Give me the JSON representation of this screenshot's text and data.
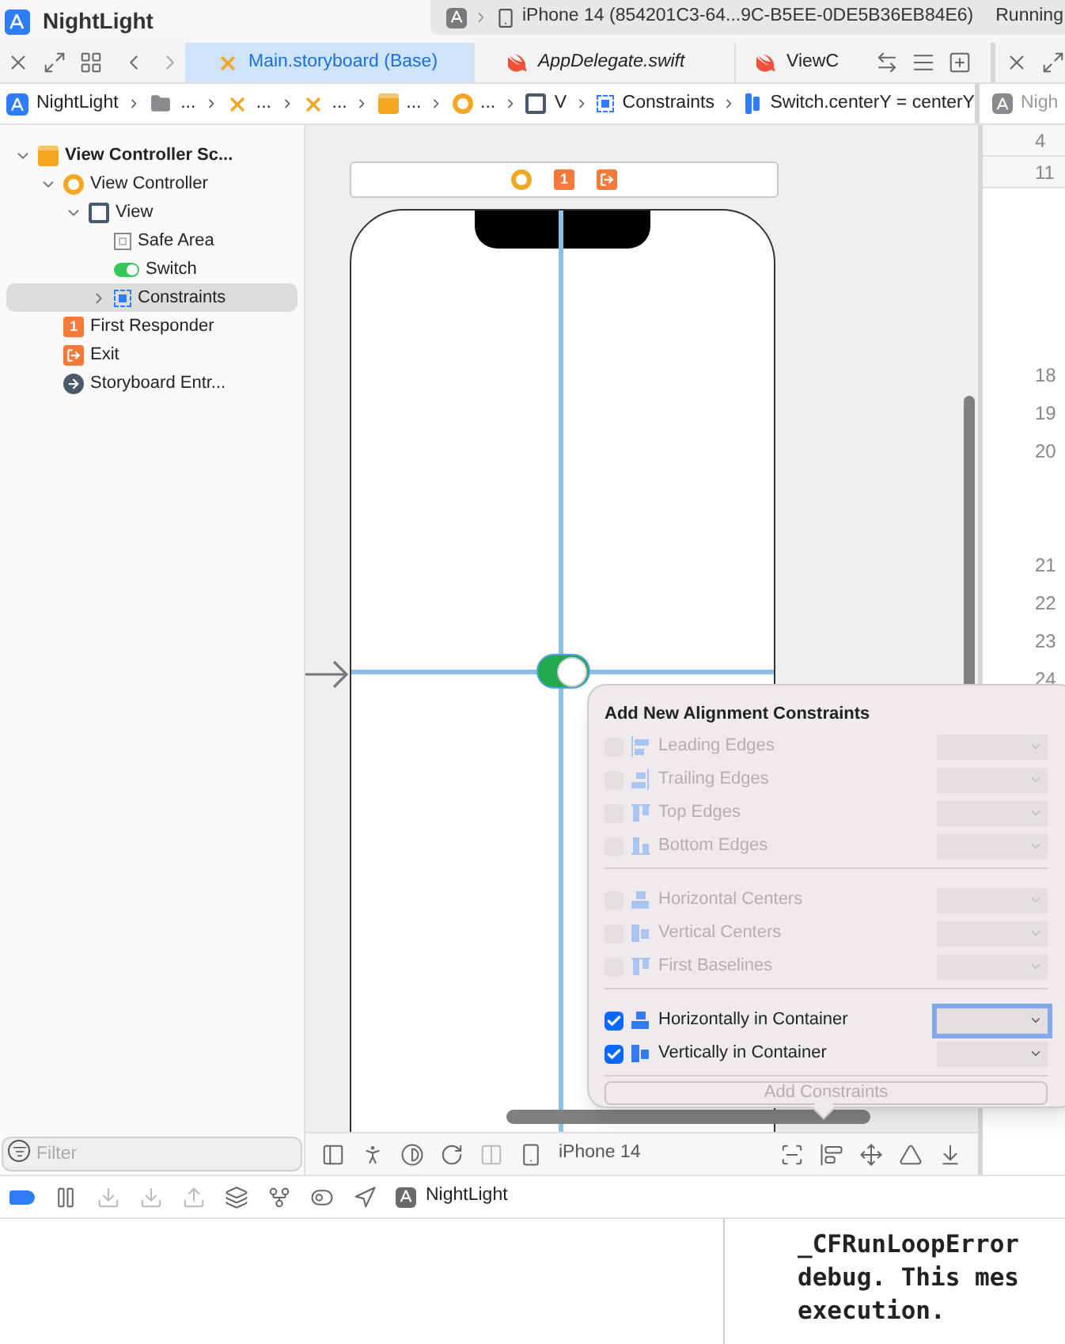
{
  "app": {
    "name": "NightLight"
  },
  "run_status": {
    "device": "iPhone 14 (854201C3-64...9C-B5EE-0DE5B36EB84E6)",
    "status": "Running"
  },
  "tabs": [
    {
      "label": "Main.storyboard (Base)",
      "kind": "storyboard",
      "selected": true
    },
    {
      "label": "AppDelegate.swift",
      "kind": "swift",
      "selected": false
    },
    {
      "label": "ViewC",
      "kind": "swift",
      "selected": false
    }
  ],
  "breadcrumb": [
    {
      "label": "NightLight",
      "kind": "app"
    },
    {
      "label": "...",
      "kind": "folder"
    },
    {
      "label": "...",
      "kind": "storyboard"
    },
    {
      "label": "...",
      "kind": "storyboard"
    },
    {
      "label": "...",
      "kind": "scene"
    },
    {
      "label": "...",
      "kind": "controller"
    },
    {
      "label": "V",
      "kind": "view"
    },
    {
      "label": "Constraints",
      "kind": "constraints"
    },
    {
      "label": "Switch.centerY = centerY",
      "kind": "constraint"
    }
  ],
  "side_breadcrumb": "Nigh",
  "navigator": {
    "items": [
      {
        "label": "View Controller Sc...",
        "kind": "scene",
        "expanded": true,
        "selected": false,
        "children": [
          {
            "label": "View Controller",
            "kind": "controller",
            "expanded": true,
            "selected": false,
            "children": [
              {
                "label": "View",
                "kind": "view",
                "expanded": true,
                "selected": false,
                "children": [
                  {
                    "label": "Safe Area",
                    "kind": "safe-area",
                    "selected": false
                  },
                  {
                    "label": "Switch",
                    "kind": "switch",
                    "selected": false
                  },
                  {
                    "label": "Constraints",
                    "kind": "constraints",
                    "expanded": false,
                    "selected": true
                  }
                ]
              }
            ]
          },
          {
            "label": "First Responder",
            "kind": "responder",
            "badge": "1",
            "selected": false
          },
          {
            "label": "Exit",
            "kind": "exit",
            "selected": false
          },
          {
            "label": "Storyboard Entr...",
            "kind": "entry",
            "selected": false
          }
        ]
      }
    ],
    "filter": {
      "placeholder": "Filter"
    }
  },
  "canvas": {
    "dock": [
      {
        "kind": "controller"
      },
      {
        "kind": "responder",
        "badge": "1"
      },
      {
        "kind": "exit"
      }
    ],
    "switch": {
      "on": true
    },
    "device": "iPhone 14"
  },
  "code": {
    "sticky_lines": [
      "4",
      "11"
    ],
    "lines": [
      {
        "number": "18",
        "wrapped": false
      },
      {
        "number": "19",
        "wrapped": false
      },
      {
        "number": "20",
        "wrapped": true
      },
      {
        "number": "21",
        "wrapped": false
      },
      {
        "number": "22",
        "wrapped": false
      },
      {
        "number": "23",
        "wrapped": false
      },
      {
        "number": "24",
        "wrapped": false
      }
    ]
  },
  "popover": {
    "title": "Add New Alignment Constraints",
    "groups": [
      {
        "rows": [
          {
            "label": "Leading Edges",
            "kind": "leading",
            "checked": false,
            "disabled": true,
            "focused": false
          },
          {
            "label": "Trailing Edges",
            "kind": "trailing",
            "checked": false,
            "disabled": true,
            "focused": false
          },
          {
            "label": "Top Edges",
            "kind": "top",
            "checked": false,
            "disabled": true,
            "focused": false
          },
          {
            "label": "Bottom Edges",
            "kind": "bottom",
            "checked": false,
            "disabled": true,
            "focused": false
          }
        ]
      },
      {
        "rows": [
          {
            "label": "Horizontal Centers",
            "kind": "hcenter",
            "checked": false,
            "disabled": true,
            "focused": false
          },
          {
            "label": "Vertical Centers",
            "kind": "vcenter",
            "checked": false,
            "disabled": true,
            "focused": false
          },
          {
            "label": "First Baselines",
            "kind": "top",
            "checked": false,
            "disabled": true,
            "focused": false
          }
        ]
      },
      {
        "rows": [
          {
            "label": "Horizontally in Container",
            "kind": "hcenter",
            "checked": true,
            "disabled": false,
            "focused": true
          },
          {
            "label": "Vertically in Container",
            "kind": "vcenter",
            "checked": true,
            "disabled": false,
            "focused": false
          }
        ]
      }
    ],
    "button": {
      "label": "Add Constraints",
      "disabled": true
    }
  },
  "debug_bar": {
    "breakpoints_on": true,
    "target": "NightLight"
  },
  "console": {
    "lines": [
      "_CFRunLoopError",
      "debug. This mes",
      "execution."
    ]
  }
}
